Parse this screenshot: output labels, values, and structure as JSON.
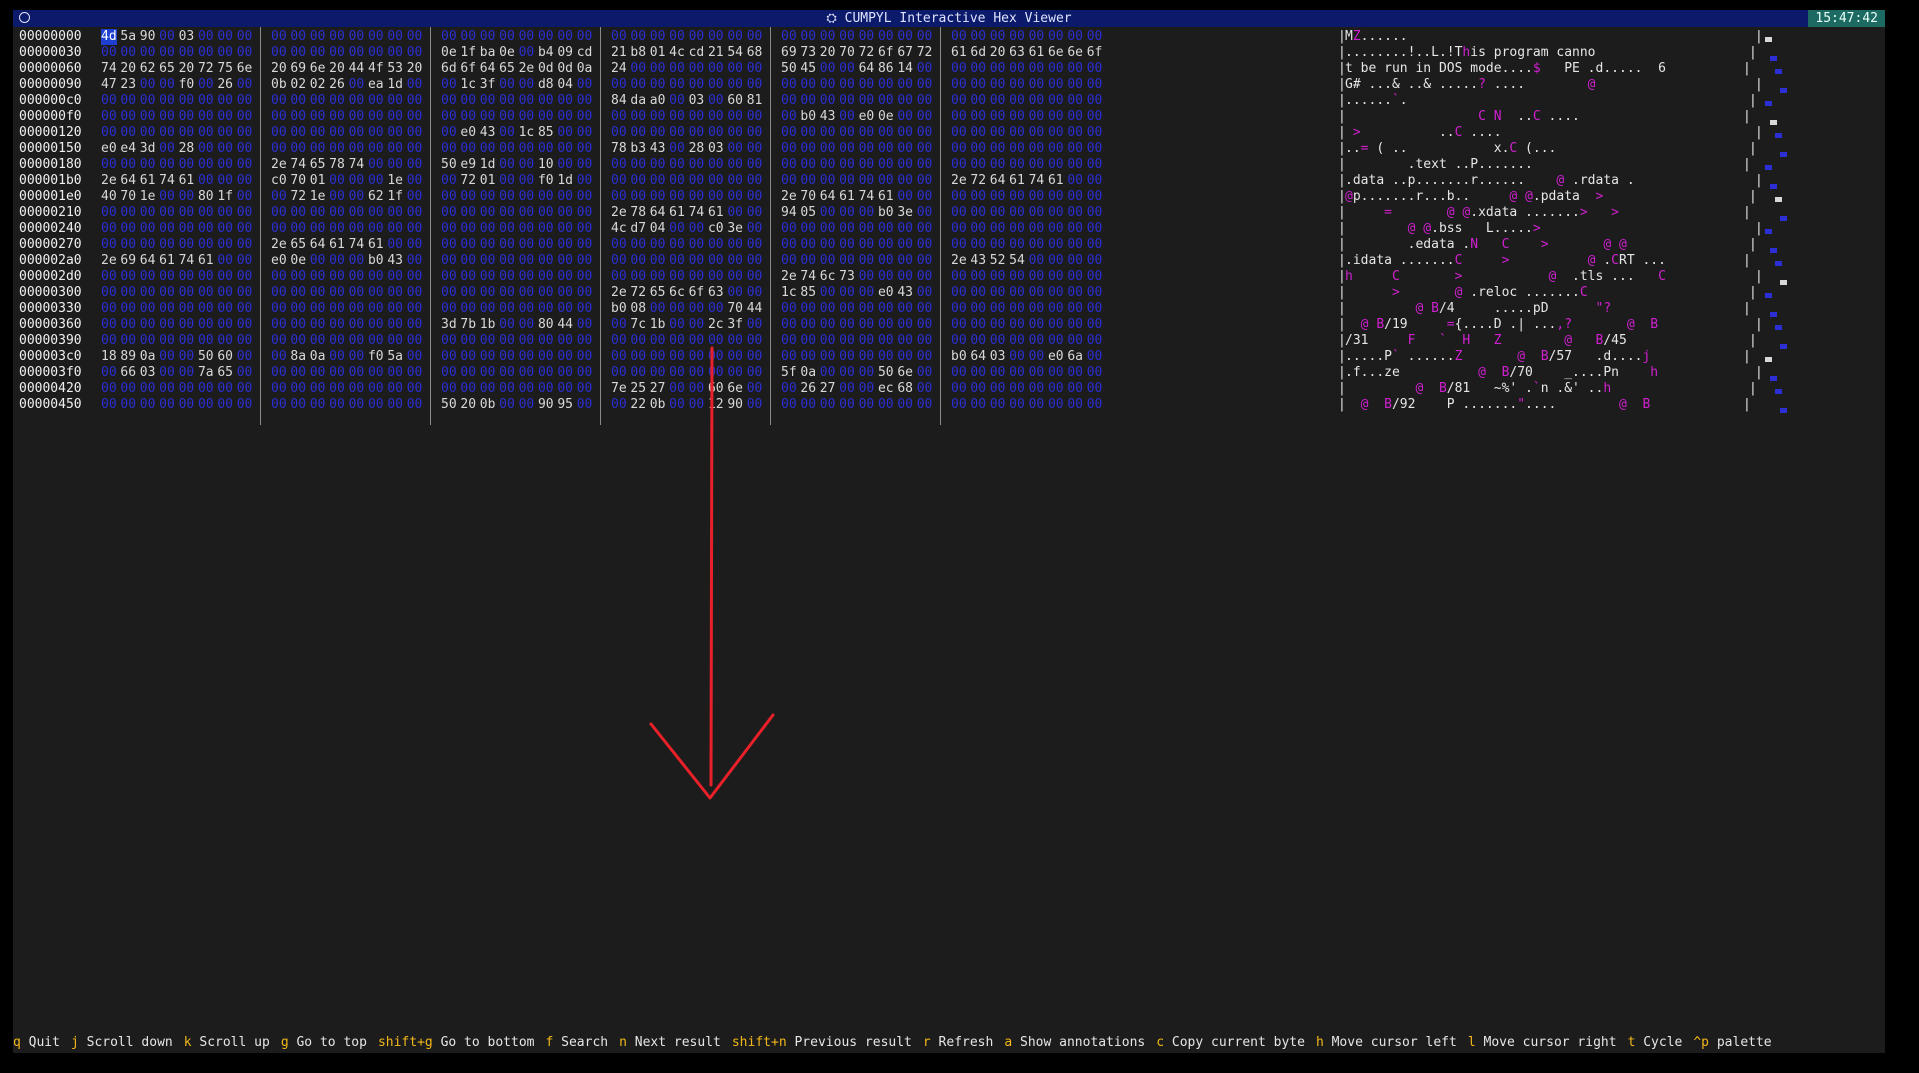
{
  "window": {
    "title": "CUMPYL Interactive Hex Viewer",
    "clock": "15:47:42"
  },
  "colors": {
    "titlebar": "#0b1a6b",
    "clock_bg": "#1c6a62",
    "zero_byte": "#2c2fd3",
    "marker": "#d020d0",
    "key": "#f2b81a",
    "arrow": "#e8202a"
  },
  "rows": [
    {
      "off": "00000000",
      "g": [
        "4d 5a 90 00 03 00 00 00",
        "00 00 00 00 00 00 00 00",
        "00 00 00 00 00 00 00 00",
        "00 00 00 00 00 00 00 00",
        "00 00 00 00 00 00 00 00",
        "00 00 00 00 00 00 00 00"
      ],
      "a": "MZ......"
    },
    {
      "off": "00000030",
      "g": [
        "00 00 00 00 00 00 00 00",
        "00 00 00 00 00 00 00 00",
        "0e 1f ba 0e 00 b4 09 cd",
        "21 b8 01 4c cd 21 54 68",
        "69 73 20 70 72 6f 67 72",
        "61 6d 20 63 61 6e 6e 6f"
      ],
      "a": "........!..L.!This program canno"
    },
    {
      "off": "00000060",
      "g": [
        "74 20 62 65 20 72 75 6e",
        "20 69 6e 20 44 4f 53 20",
        "6d 6f 64 65 2e 0d 0d 0a",
        "24 00 00 00 00 00 00 00",
        "50 45 00 00 64 86 14 00",
        "00 00 00 00 00 00 00 00"
      ],
      "a": "t be run in DOS mode....$   PE .d.....  6"
    },
    {
      "off": "00000090",
      "g": [
        "47 23 00 00 f0 00 26 00",
        "0b 02 02 26 00 ea 1d 00",
        "00 1c 3f 00 00 d8 04 00",
        "00 00 00 00 00 00 00 00",
        "00 00 00 00 00 00 00 00",
        "00 00 00 00 00 00 00 00"
      ],
      "a": "G# ...& ..& .....? ....        @"
    },
    {
      "off": "000000c0",
      "g": [
        "00 00 00 00 00 00 00 00",
        "00 00 00 00 00 00 00 00",
        "00 00 00 00 00 00 00 00",
        "84 da a0 00 03 00 60 81",
        "00 00 00 00 00 00 00 00",
        "00 00 00 00 00 00 00 00"
      ],
      "a": "......`."
    },
    {
      "off": "000000f0",
      "g": [
        "00 00 00 00 00 00 00 00",
        "00 00 00 00 00 00 00 00",
        "00 00 00 00 00 00 00 00",
        "00 00 00 00 00 00 00 00",
        "00 b0 43 00 e0 0e 00 00",
        "00 00 00 00 00 00 00 00"
      ],
      "a": "                 C N  ..C ...."
    },
    {
      "off": "00000120",
      "g": [
        "00 00 00 00 00 00 00 00",
        "00 00 00 00 00 00 00 00",
        "00 e0 43 00 1c 85 00 00",
        "00 00 00 00 00 00 00 00",
        "00 00 00 00 00 00 00 00",
        "00 00 00 00 00 00 00 00"
      ],
      "a": " >          ..C ...."
    },
    {
      "off": "00000150",
      "g": [
        "e0 e4 3d 00 28 00 00 00",
        "00 00 00 00 00 00 00 00",
        "00 00 00 00 00 00 00 00",
        "78 b3 43 00 28 03 00 00",
        "00 00 00 00 00 00 00 00",
        "00 00 00 00 00 00 00 00"
      ],
      "a": "..= ( ..           x.C (..."
    },
    {
      "off": "00000180",
      "g": [
        "00 00 00 00 00 00 00 00",
        "2e 74 65 78 74 00 00 00",
        "50 e9 1d 00 00 10 00 00",
        "00 00 00 00 00 00 00 00",
        "00 00 00 00 00 00 00 00",
        "00 00 00 00 00 00 00 00"
      ],
      "a": "        .text ..P......."
    },
    {
      "off": "000001b0",
      "g": [
        "2e 64 61 74 61 00 00 00",
        "c0 70 01 00 00 00 1e 00",
        "00 72 01 00 00 f0 1d 00",
        "00 00 00 00 00 00 00 00",
        "00 00 00 00 00 00 00 00",
        "2e 72 64 61 74 61 00 00"
      ],
      "a": ".data ..p.......r......    @ .rdata ."
    },
    {
      "off": "000001e0",
      "g": [
        "40 70 1e 00 00 80 1f 00",
        "00 72 1e 00 00 62 1f 00",
        "00 00 00 00 00 00 00 00",
        "00 00 00 00 00 00 00 00",
        "2e 70 64 61 74 61 00 00",
        "00 00 00 00 00 00 00 00"
      ],
      "a": "@p.......r...b..     @ @.pdata  >"
    },
    {
      "off": "00000210",
      "g": [
        "00 00 00 00 00 00 00 00",
        "00 00 00 00 00 00 00 00",
        "00 00 00 00 00 00 00 00",
        "2e 78 64 61 74 61 00 00",
        "94 05 00 00 00 b0 3e 00",
        "00 00 00 00 00 00 00 00"
      ],
      "a": "     =       @ @.xdata .......>   >"
    },
    {
      "off": "00000240",
      "g": [
        "00 00 00 00 00 00 00 00",
        "00 00 00 00 00 00 00 00",
        "00 00 00 00 00 00 00 00",
        "4c d7 04 00 00 c0 3e 00",
        "00 00 00 00 00 00 00 00",
        "00 00 00 00 00 00 00 00"
      ],
      "a": "        @ @.bss   L.....>"
    },
    {
      "off": "00000270",
      "g": [
        "00 00 00 00 00 00 00 00",
        "2e 65 64 61 74 61 00 00",
        "00 00 00 00 00 00 00 00",
        "00 00 00 00 00 00 00 00",
        "00 00 00 00 00 00 00 00",
        "00 00 00 00 00 00 00 00"
      ],
      "a": "        .edata .N   C    >       @ @"
    },
    {
      "off": "000002a0",
      "g": [
        "2e 69 64 61 74 61 00 00",
        "e0 0e 00 00 00 b0 43 00",
        "00 00 00 00 00 00 00 00",
        "00 00 00 00 00 00 00 00",
        "00 00 00 00 00 00 00 00",
        "2e 43 52 54 00 00 00 00"
      ],
      "a": ".idata .......C     >          @ .CRT ..."
    },
    {
      "off": "000002d0",
      "g": [
        "00 00 00 00 00 00 00 00",
        "00 00 00 00 00 00 00 00",
        "00 00 00 00 00 00 00 00",
        "00 00 00 00 00 00 00 00",
        "2e 74 6c 73 00 00 00 00",
        "00 00 00 00 00 00 00 00"
      ],
      "a": "h     C       >           @  .tls ...   C"
    },
    {
      "off": "00000300",
      "g": [
        "00 00 00 00 00 00 00 00",
        "00 00 00 00 00 00 00 00",
        "00 00 00 00 00 00 00 00",
        "2e 72 65 6c 6f 63 00 00",
        "1c 85 00 00 00 e0 43 00",
        "00 00 00 00 00 00 00 00"
      ],
      "a": "      >       @ .reloc .......C"
    },
    {
      "off": "00000330",
      "g": [
        "00 00 00 00 00 00 00 00",
        "00 00 00 00 00 00 00 00",
        "00 00 00 00 00 00 00 00",
        "b0 08 00 00 00 00 70 44",
        "00 00 00 00 00 00 00 00",
        "00 00 00 00 00 00 00 00"
      ],
      "a": "         @ B/4     .....pD      \"?"
    },
    {
      "off": "00000360",
      "g": [
        "00 00 00 00 00 00 00 00",
        "00 00 00 00 00 00 00 00",
        "3d 7b 1b 00 00 80 44 00",
        "00 7c 1b 00 00 2c 3f 00",
        "00 00 00 00 00 00 00 00",
        "00 00 00 00 00 00 00 00"
      ],
      "a": "  @ B/19     ={....D .| ...,?       @  B"
    },
    {
      "off": "00000390",
      "g": [
        "00 00 00 00 00 00 00 00",
        "00 00 00 00 00 00 00 00",
        "00 00 00 00 00 00 00 00",
        "00 00 00 00 00 00 00 00",
        "00 00 00 00 00 00 00 00",
        "00 00 00 00 00 00 00 00"
      ],
      "a": "/31     F   `  H   Z        @   B/45"
    },
    {
      "off": "000003c0",
      "g": [
        "18 89 0a 00 00 50 60 00",
        "00 8a 0a 00 00 f0 5a 00",
        "00 00 00 00 00 00 00 00",
        "00 00 00 00 00 00 00 00",
        "00 00 00 00 00 00 00 00",
        "b0 64 03 00 00 e0 6a 00"
      ],
      "a": ".....P` ......Z       @  B/57   .d....j"
    },
    {
      "off": "000003f0",
      "g": [
        "00 66 03 00 00 7a 65 00",
        "00 00 00 00 00 00 00 00",
        "00 00 00 00 00 00 00 00",
        "00 00 00 00 00 00 00 00",
        "5f 0a 00 00 00 50 6e 00",
        "00 00 00 00 00 00 00 00"
      ],
      "a": ".f...ze          @  B/70    _....Pn    h"
    },
    {
      "off": "00000420",
      "g": [
        "00 00 00 00 00 00 00 00",
        "00 00 00 00 00 00 00 00",
        "00 00 00 00 00 00 00 00",
        "7e 25 27 00 00 60 6e 00",
        "00 26 27 00 00 ec 68 00",
        "00 00 00 00 00 00 00 00"
      ],
      "a": "         @  B/81   ~%' .`n .&' ..h"
    },
    {
      "off": "00000450",
      "g": [
        "00 00 00 00 00 00 00 00",
        "00 00 00 00 00 00 00 00",
        "50 20 0b 00 00 90 95 00",
        "00 22 0b 00 00 12 90 00",
        "00 00 00 00 00 00 00 00",
        "00 00 00 00 00 00 00 00"
      ],
      "a": "  @  B/92    P .......\"....        @  B"
    }
  ],
  "footer": [
    {
      "key": "q",
      "label": "Quit"
    },
    {
      "key": "j",
      "label": "Scroll down"
    },
    {
      "key": "k",
      "label": "Scroll up"
    },
    {
      "key": "g",
      "label": "Go to top"
    },
    {
      "key": "shift+g",
      "label": "Go to bottom"
    },
    {
      "key": "f",
      "label": "Search"
    },
    {
      "key": "n",
      "label": "Next result"
    },
    {
      "key": "shift+n",
      "label": "Previous result"
    },
    {
      "key": "r",
      "label": "Refresh"
    },
    {
      "key": "a",
      "label": "Show annotations"
    },
    {
      "key": "c",
      "label": "Copy current byte"
    },
    {
      "key": "h",
      "label": "Move cursor left"
    },
    {
      "key": "l",
      "label": "Move cursor right"
    },
    {
      "key": "t",
      "label": "Cycle"
    },
    {
      "key": "^p",
      "label": "palette"
    }
  ]
}
